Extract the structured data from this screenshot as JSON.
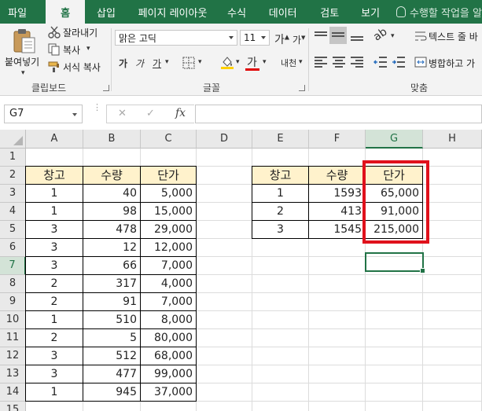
{
  "ribbon_tabs": [
    "파일",
    "홈",
    "삽입",
    "페이지 레이아웃",
    "수식",
    "데이터",
    "검토",
    "보기"
  ],
  "active_tab": "홈",
  "tell_me_placeholder": "수행할 작업을 알",
  "clipboard": {
    "paste": "붙여넣기",
    "cut": "잘라내기",
    "copy": "복사",
    "format_painter": "서식 복사",
    "group_label": "클립보드"
  },
  "font": {
    "name": "맑은 고딕",
    "size": "11",
    "grow": "가",
    "shrink": "가",
    "bold": "가",
    "italic": "가",
    "underline": "가",
    "font_color_glyph": "가",
    "phonetic": "내천",
    "font_color_bar": "#e00000",
    "group_label": "글꼴"
  },
  "alignment": {
    "wrap_text": "텍스트 줄 바",
    "merge_center": "병합하고 가",
    "group_label": "맞춤"
  },
  "formula_bar": {
    "name_box": "G7",
    "cancel": "✕",
    "enter": "✓",
    "fx": "fx",
    "value": ""
  },
  "columns": [
    "A",
    "B",
    "C",
    "D",
    "E",
    "F",
    "G",
    "H"
  ],
  "rows": [
    "1",
    "2",
    "3",
    "4",
    "5",
    "6",
    "7",
    "8",
    "9",
    "10",
    "11",
    "12",
    "13",
    "14",
    "15"
  ],
  "selected_cell": "G7",
  "table1": {
    "headers": [
      "창고",
      "수량",
      "단가"
    ],
    "rows": [
      [
        "1",
        "40",
        "5,000"
      ],
      [
        "1",
        "98",
        "15,000"
      ],
      [
        "3",
        "478",
        "29,000"
      ],
      [
        "3",
        "12",
        "12,000"
      ],
      [
        "3",
        "66",
        "7,000"
      ],
      [
        "2",
        "317",
        "4,000"
      ],
      [
        "2",
        "91",
        "7,000"
      ],
      [
        "1",
        "510",
        "8,000"
      ],
      [
        "2",
        "5",
        "80,000"
      ],
      [
        "3",
        "512",
        "68,000"
      ],
      [
        "3",
        "477",
        "99,000"
      ],
      [
        "1",
        "945",
        "37,000"
      ]
    ]
  },
  "table2": {
    "headers": [
      "창고",
      "수량",
      "단가"
    ],
    "rows": [
      [
        "1",
        "1593",
        "65,000"
      ],
      [
        "2",
        "413",
        "91,000"
      ],
      [
        "3",
        "1545",
        "215,000"
      ]
    ]
  },
  "colors": {
    "excel_green": "#217346",
    "header_fill": "#fff2cc",
    "highlight_red": "#e0111c"
  }
}
